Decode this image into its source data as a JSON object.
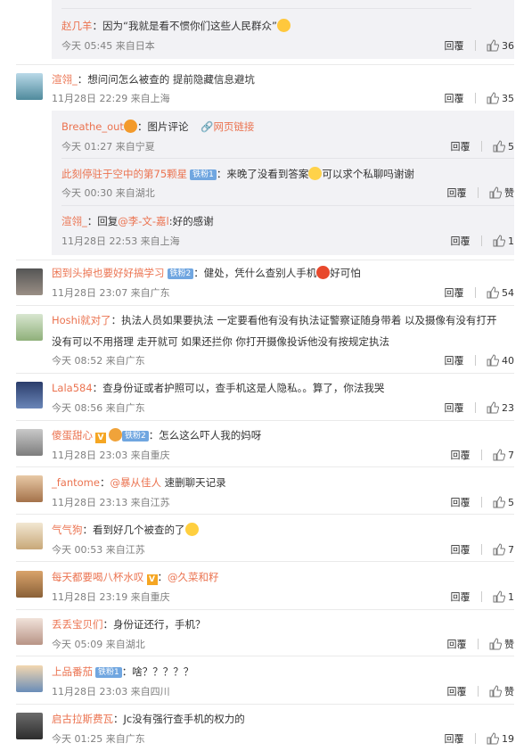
{
  "comments": {
    "c0": {
      "reply": {
        "nick": "赵几羊",
        "text": "：因为“我就是看不惯你们这些人民群众”",
        "meta": "今天 05:45 来自日本",
        "likes": "36"
      }
    },
    "c1": {
      "nick": "渲翎_",
      "text": "：想问问怎么被查的 提前隐藏信息避坑",
      "meta": "11月28日 22:29 来自上海",
      "likes": "35",
      "replies": [
        {
          "nick": "Breathe_out",
          "text": "：图片评论",
          "link": "网页链接",
          "meta": "今天 01:27 来自宁夏",
          "likes": "5"
        },
        {
          "nick": "此刻停驻于空中的第75颗星",
          "badge": "铁粉1",
          "text": "：来晚了没看到答案",
          "text2": "可以求个私聊吗谢谢",
          "meta": "今天 00:30 来自湖北",
          "likes": "赞"
        },
        {
          "nick": "渲翎_",
          "text": "：回复",
          "at": "@李-文-嘉l",
          "text2": ":好的感谢",
          "meta": "11月28日 22:53 来自上海",
          "likes": "1"
        }
      ]
    },
    "c2": {
      "nick": "困到头掉也要好好搞学习",
      "badge": "铁粉2",
      "text": "：健处，凭什么查别人手机",
      "text2": "好可怕",
      "meta": "11月28日 23:07 来自广东",
      "likes": "54"
    },
    "c3": {
      "nick": "Hoshi就对了",
      "text": "：执法人员如果要执法 一定要看他有没有执法证警察证随身带着 以及摄像有没有打开",
      "line2": "没有可以不用搭理 走开就可 如果还拦你 你打开摄像投诉他没有按规定执法",
      "meta": "今天 08:52 来自广东",
      "likes": "40"
    },
    "c4": {
      "nick": "Lala584",
      "text": "：查身份证或者护照可以，查手机这是人隐私。。算了，你法我哭",
      "meta": "今天 08:56 来自广东",
      "likes": "23"
    },
    "c5": {
      "nick": "傻蛋甜心",
      "badge": "铁粉2",
      "text": "：怎么这么吓人我的妈呀",
      "meta": "11月28日 23:03 来自重庆",
      "likes": "7"
    },
    "c6": {
      "nick": "_fantome",
      "at": "@暴从佳人",
      "text": " 速删聊天记录",
      "meta": "11月28日 23:13 来自江苏",
      "likes": "5"
    },
    "c7": {
      "nick": "气气狗",
      "text": "：看到好几个被查的了",
      "meta": "今天 00:53 来自江苏",
      "likes": "7"
    },
    "c8": {
      "nick": "每天都要喝八杯水叹",
      "text": "：",
      "at": "@久菜和籽",
      "meta": "11月28日 23:19 来自重庆",
      "likes": "1"
    },
    "c9": {
      "nick": "丢丢宝贝们",
      "text": "：身份证还行，手机？",
      "meta": "今天 05:09 来自湖北",
      "likes": "赞"
    },
    "c10": {
      "nick": "上品番茄",
      "badge": "铁粉1",
      "text": "：啥？？？？？",
      "meta": "11月28日 23:03 来自四川",
      "likes": "赞"
    },
    "c11": {
      "nick": "启古拉斯费瓦",
      "text": "：Jc没有强行查手机的权力的",
      "meta": "今天 01:25 来自广东",
      "likes": "19"
    }
  },
  "actions": {
    "reply": "回覆"
  },
  "colors": {
    "nick": "#eb7350",
    "meta": "#808080",
    "subbg": "#f2f2f5",
    "badge": "#70a6e0"
  }
}
